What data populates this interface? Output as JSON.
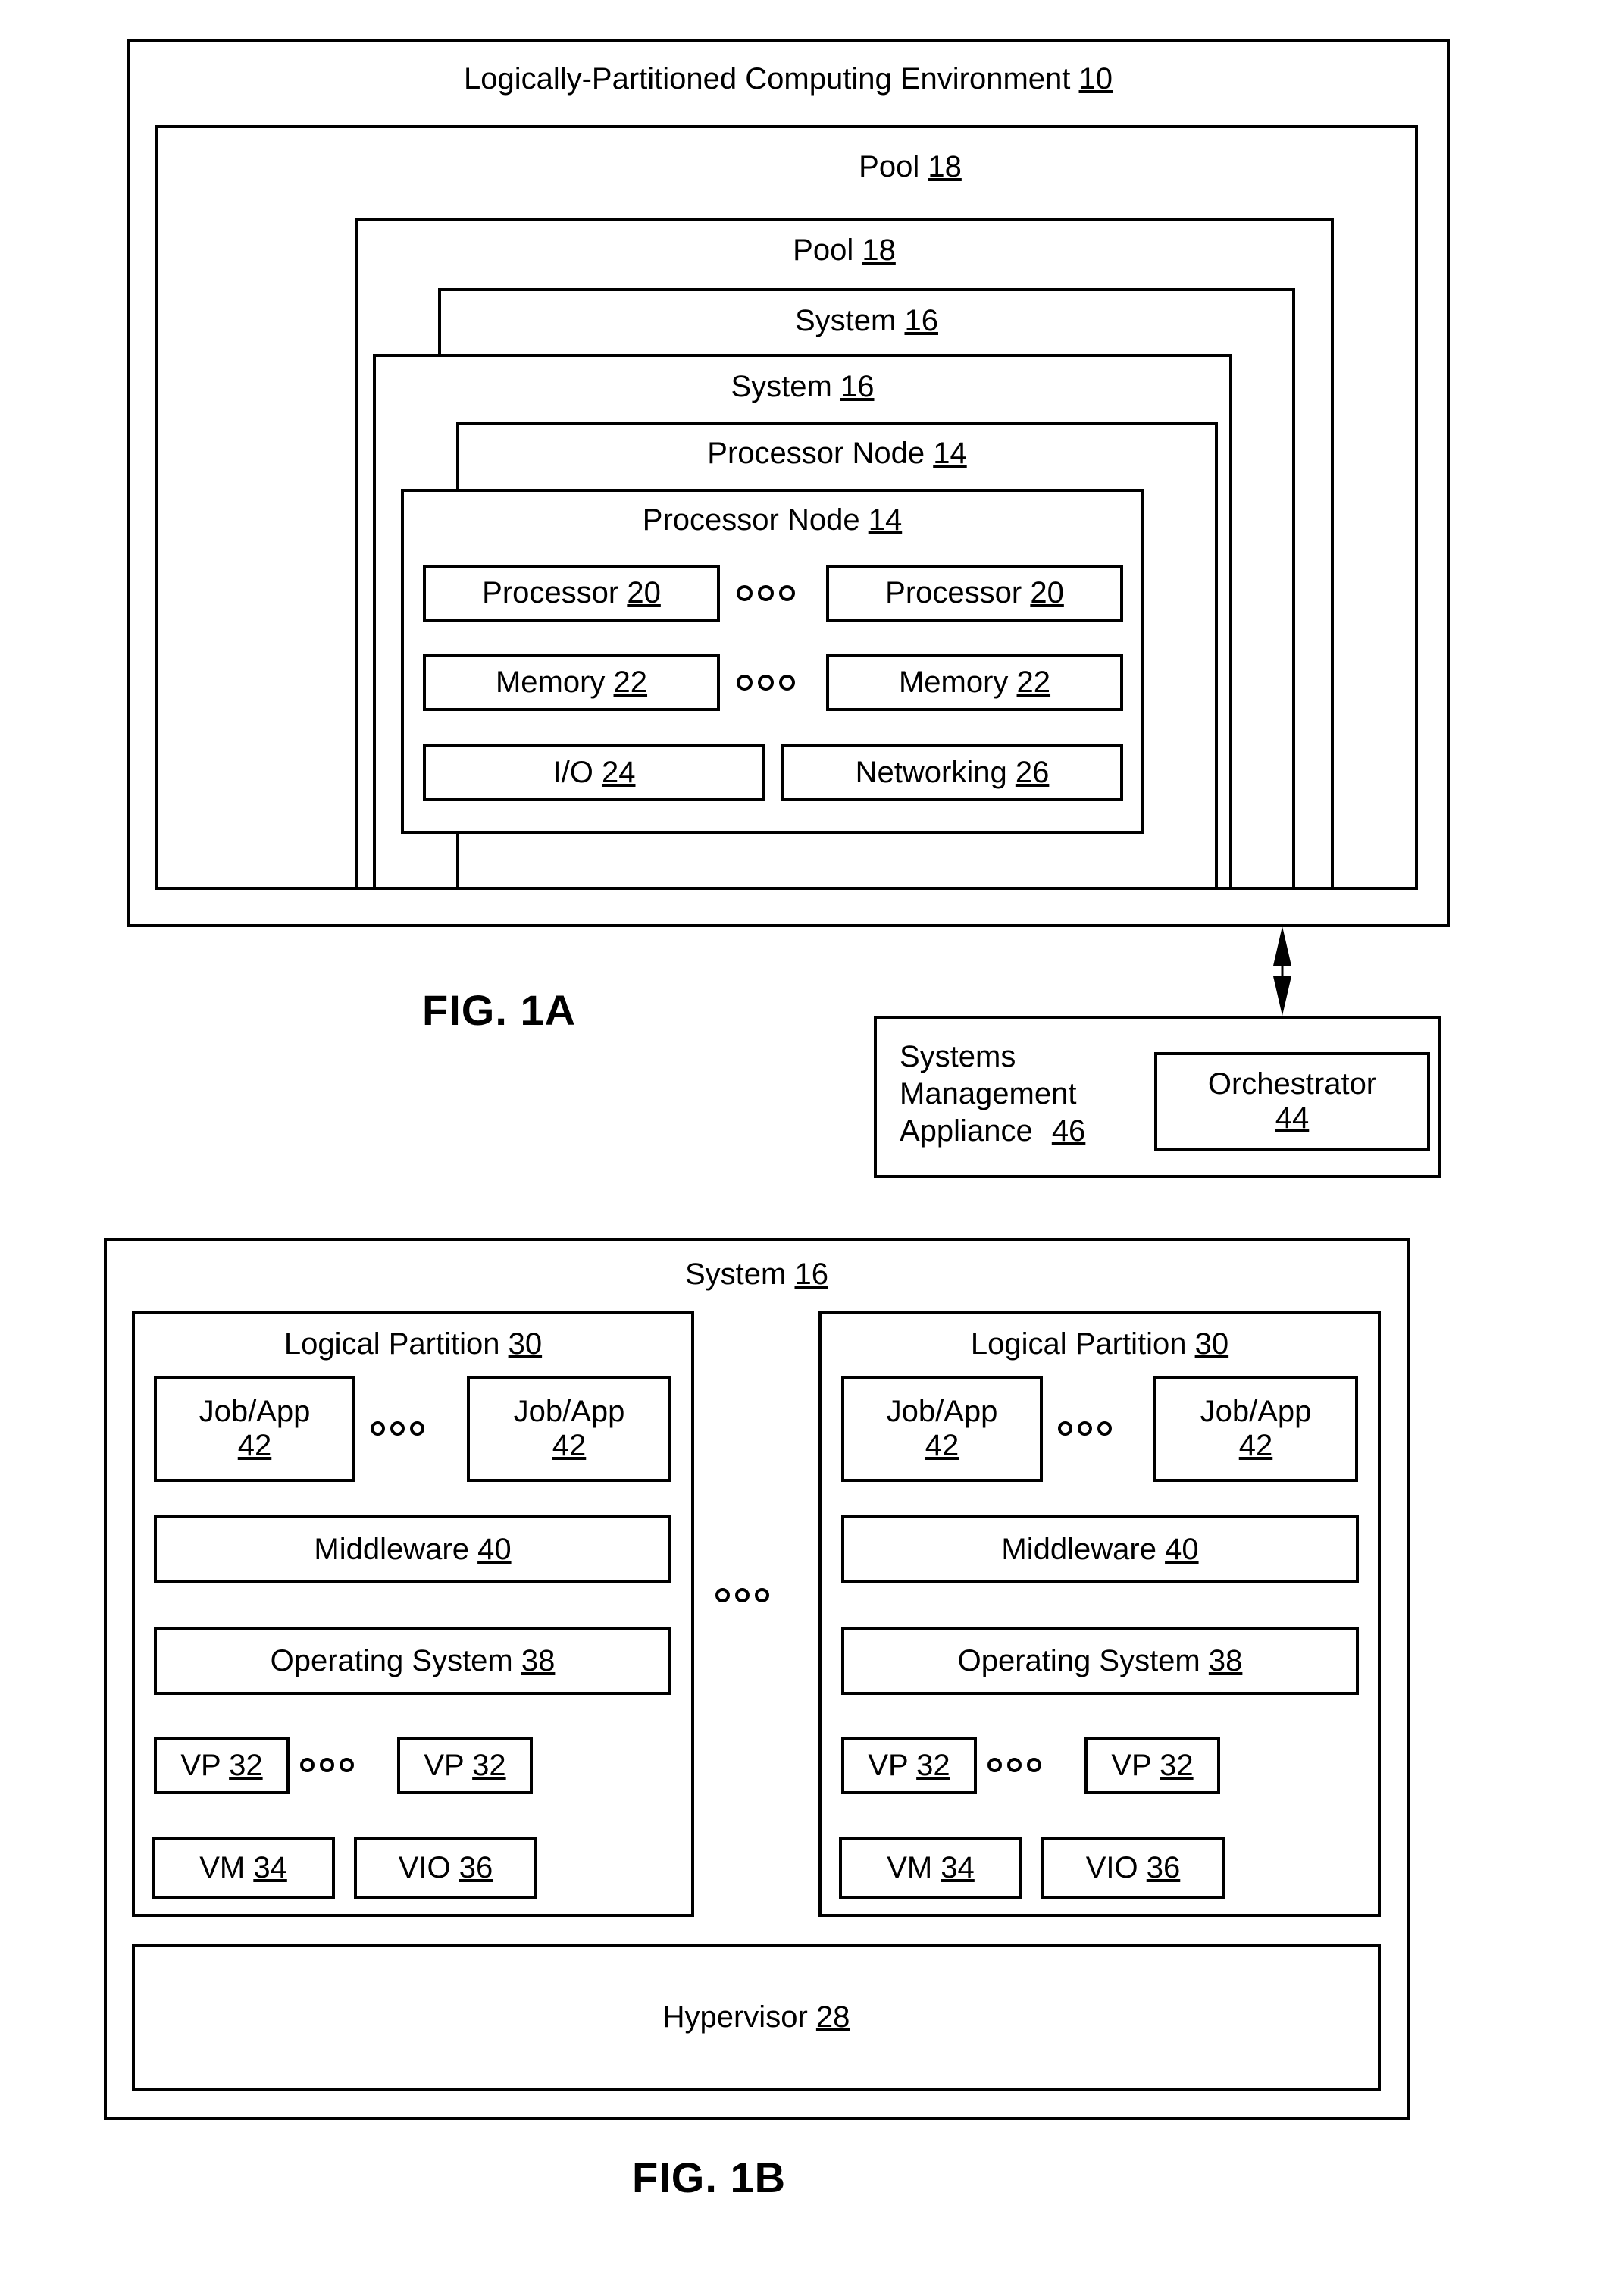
{
  "figures": [
    {
      "id": "fig1a",
      "caption": "FIG. 1A"
    },
    {
      "id": "fig1b",
      "caption": "FIG. 1B"
    }
  ],
  "fig1a": {
    "environment": {
      "label": "Logically-Partitioned Computing Environment",
      "ref": "10"
    },
    "pool_back": {
      "label": "Pool",
      "ref": "18"
    },
    "pool_front": {
      "label": "Pool",
      "ref": "18"
    },
    "system_back": {
      "label": "System",
      "ref": "16"
    },
    "system_front": {
      "label": "System",
      "ref": "16"
    },
    "node_back": {
      "label": "Processor Node",
      "ref": "14"
    },
    "node_front": {
      "label": "Processor Node",
      "ref": "14"
    },
    "components": {
      "processor_left": {
        "label": "Processor",
        "ref": "20"
      },
      "processor_right": {
        "label": "Processor",
        "ref": "20"
      },
      "memory_left": {
        "label": "Memory",
        "ref": "22"
      },
      "memory_right": {
        "label": "Memory",
        "ref": "22"
      },
      "io": {
        "label": "I/O",
        "ref": "24"
      },
      "networking": {
        "label": "Networking",
        "ref": "26"
      }
    },
    "appliance": {
      "line1": "Systems",
      "line2": "Management",
      "line3": "Appliance",
      "ref": "46",
      "orchestrator": {
        "label": "Orchestrator",
        "ref": "44"
      }
    },
    "caption": "FIG. 1A"
  },
  "fig1b": {
    "system": {
      "label": "System",
      "ref": "16"
    },
    "hypervisor": {
      "label": "Hypervisor",
      "ref": "28"
    },
    "partitions": [
      {
        "title": {
          "label": "Logical Partition",
          "ref": "30"
        },
        "jobapp_left": {
          "label": "Job/App",
          "ref": "42"
        },
        "jobapp_right": {
          "label": "Job/App",
          "ref": "42"
        },
        "middleware": {
          "label": "Middleware",
          "ref": "40"
        },
        "operating_system": {
          "label": "Operating System",
          "ref": "38"
        },
        "vp_left": {
          "label": "VP",
          "ref": "32"
        },
        "vp_right": {
          "label": "VP",
          "ref": "32"
        },
        "vm": {
          "label": "VM",
          "ref": "34"
        },
        "vio": {
          "label": "VIO",
          "ref": "36"
        }
      },
      {
        "title": {
          "label": "Logical Partition",
          "ref": "30"
        },
        "jobapp_left": {
          "label": "Job/App",
          "ref": "42"
        },
        "jobapp_right": {
          "label": "Job/App",
          "ref": "42"
        },
        "middleware": {
          "label": "Middleware",
          "ref": "40"
        },
        "operating_system": {
          "label": "Operating System",
          "ref": "38"
        },
        "vp_left": {
          "label": "VP",
          "ref": "32"
        },
        "vp_right": {
          "label": "VP",
          "ref": "32"
        },
        "vm": {
          "label": "VM",
          "ref": "34"
        },
        "vio": {
          "label": "VIO",
          "ref": "36"
        }
      }
    ],
    "caption": "FIG. 1B"
  },
  "colors": {
    "line": "#000000",
    "background": "#ffffff"
  }
}
